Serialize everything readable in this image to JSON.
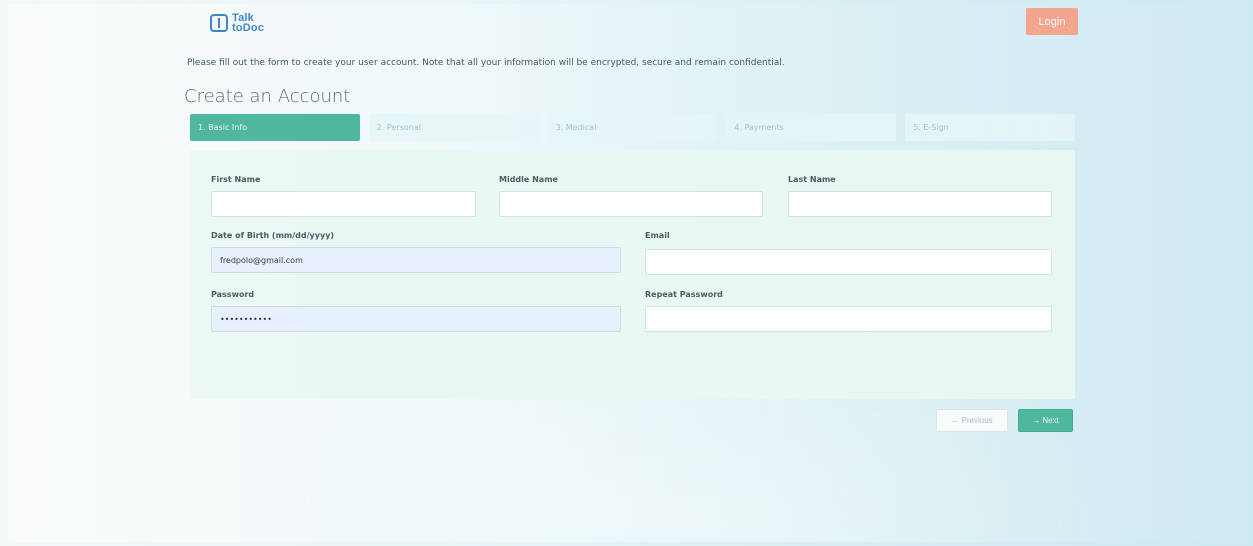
{
  "header": {
    "logo_line1": "Talk",
    "logo_line2": "toDoc",
    "login_label": "Login"
  },
  "intro_text": "Please fill out the form to create your user account. Note that all your information will be encrypted, secure and remain confidential.",
  "page_title": "Create an Account",
  "steps": [
    {
      "label": "1. Basic Info",
      "active": true
    },
    {
      "label": "2. Personal",
      "active": false
    },
    {
      "label": "3. Medical",
      "active": false
    },
    {
      "label": "4. Payments",
      "active": false
    },
    {
      "label": "5. E-Sign",
      "active": false
    }
  ],
  "form": {
    "first_name": {
      "label": "First Name",
      "value": ""
    },
    "middle_name": {
      "label": "Middle Name",
      "value": ""
    },
    "last_name": {
      "label": "Last Name",
      "value": ""
    },
    "dob": {
      "label": "Date of Birth (mm/dd/yyyy)",
      "value": "fredpolo@gmail.com"
    },
    "email": {
      "label": "Email",
      "value": ""
    },
    "password": {
      "label": "Password",
      "value": "•••••••••••"
    },
    "repeat_password": {
      "label": "Repeat Password",
      "value": ""
    }
  },
  "buttons": {
    "previous_label": "← Previous",
    "next_label": "→ Next"
  },
  "colors": {
    "accent": "#4fb79e",
    "login": "#f4a58e",
    "logo": "#3d87c6"
  }
}
